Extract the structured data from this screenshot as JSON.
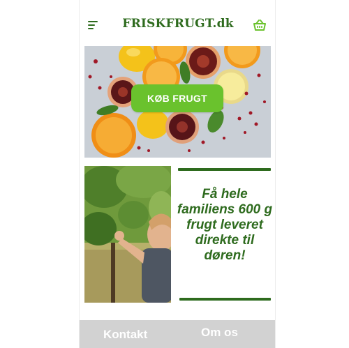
{
  "header": {
    "logo": "FRISKFRUGT.dk",
    "icons": {
      "menu": "menu-lines-icon",
      "basket": "basket-icon"
    }
  },
  "hero": {
    "image": "citrus-and-pomegranate-photo",
    "cta_label": "KØB FRUGT"
  },
  "promo": {
    "image": "child-in-vineyard-photo",
    "text": "Få hele familiens 600 g frugt leveret direkte til døren!"
  },
  "footer": {
    "links": [
      "Kontakt",
      "Om os"
    ]
  },
  "colors": {
    "brand_green": "#2e6b1e",
    "cta_green": "#6ac22d",
    "footer_gray": "#d2d2d2"
  }
}
